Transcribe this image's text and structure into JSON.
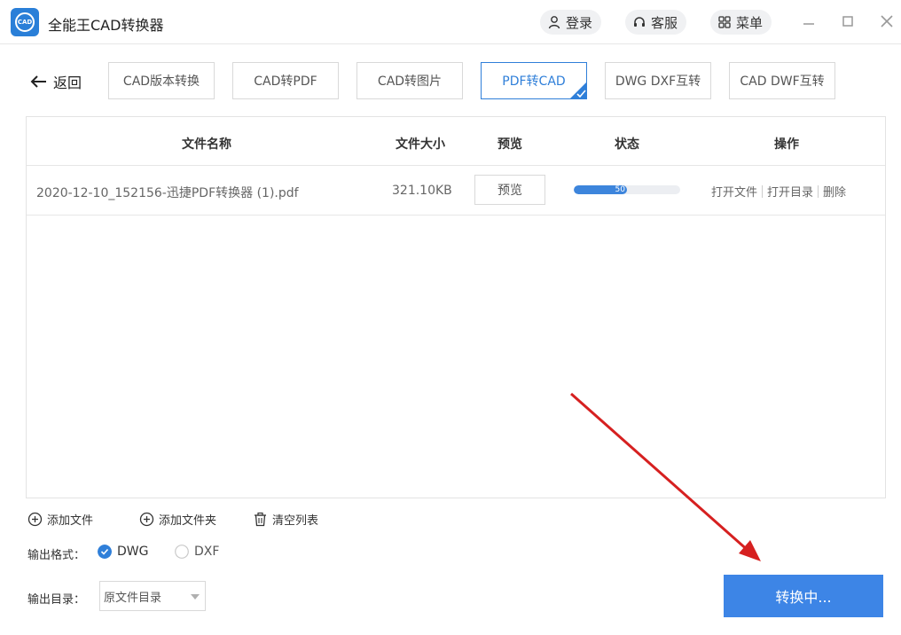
{
  "app": {
    "title": "全能王CAD转换器",
    "logo_text": "CAD"
  },
  "header": {
    "login_label": "登录",
    "service_label": "客服",
    "menu_label": "菜单"
  },
  "nav": {
    "back_label": "返回",
    "tabs": [
      {
        "label": "CAD版本转换",
        "active": false
      },
      {
        "label": "CAD转PDF",
        "active": false
      },
      {
        "label": "CAD转图片",
        "active": false
      },
      {
        "label": "PDF转CAD",
        "active": true
      },
      {
        "label": "DWG DXF互转",
        "active": false
      },
      {
        "label": "CAD DWF互转",
        "active": false
      }
    ]
  },
  "table": {
    "headers": {
      "name": "文件名称",
      "size": "文件大小",
      "preview": "预览",
      "status": "状态",
      "action": "操作"
    },
    "rows": [
      {
        "name": "2020-12-10_152156-迅捷PDF转换器 (1).pdf",
        "size": "321.10KB",
        "preview_label": "预览",
        "progress_percent": 50,
        "progress_text": "50",
        "actions": [
          "打开文件",
          "打开目录",
          "删除"
        ]
      }
    ]
  },
  "bottom": {
    "add_file_label": "添加文件",
    "add_folder_label": "添加文件夹",
    "clear_list_label": "清空列表",
    "format_label": "输出格式：",
    "format_options": [
      {
        "label": "DWG",
        "selected": true
      },
      {
        "label": "DXF",
        "selected": false
      }
    ],
    "dir_label": "输出目录：",
    "dir_value": "原文件目录",
    "convert_label": "转换中..."
  },
  "colors": {
    "accent": "#3d85e6",
    "annotation_arrow": "#d62020"
  }
}
